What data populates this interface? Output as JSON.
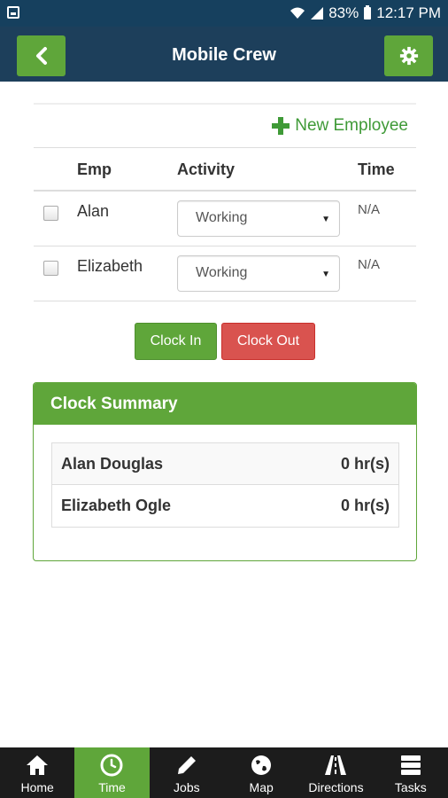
{
  "status_bar": {
    "battery": "83%",
    "time": "12:17 PM"
  },
  "header": {
    "title": "Mobile Crew"
  },
  "toolbar": {
    "new_employee_label": "New Employee"
  },
  "table": {
    "headers": {
      "emp": "Emp",
      "activity": "Activity",
      "time": "Time"
    },
    "rows": [
      {
        "name": "Alan",
        "activity": "Working",
        "time": "N/A"
      },
      {
        "name": "Elizabeth",
        "activity": "Working",
        "time": "N/A"
      }
    ]
  },
  "actions": {
    "clock_in": "Clock In",
    "clock_out": "Clock Out"
  },
  "summary": {
    "title": "Clock Summary",
    "rows": [
      {
        "name": "Alan Douglas",
        "hours": "0 hr(s)"
      },
      {
        "name": "Elizabeth Ogle",
        "hours": "0 hr(s)"
      }
    ]
  },
  "nav": {
    "items": [
      {
        "label": "Home",
        "icon": "home-icon"
      },
      {
        "label": "Time",
        "icon": "clock-icon",
        "active": true
      },
      {
        "label": "Jobs",
        "icon": "pencil-icon"
      },
      {
        "label": "Map",
        "icon": "globe-icon"
      },
      {
        "label": "Directions",
        "icon": "road-icon"
      },
      {
        "label": "Tasks",
        "icon": "server-icon"
      }
    ]
  },
  "colors": {
    "header_bg": "#1d3f5b",
    "accent_green": "#5fa63a",
    "danger_red": "#d9534f",
    "nav_bg": "#1c1c1c"
  }
}
